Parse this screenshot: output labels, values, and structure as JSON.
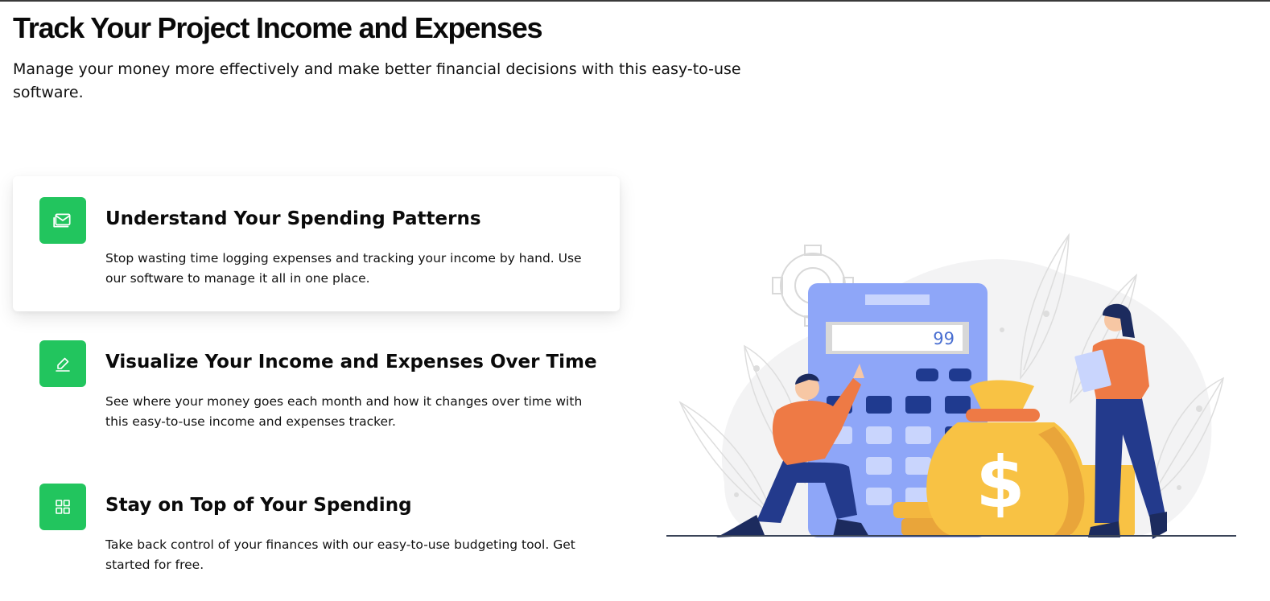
{
  "header": {
    "title": "Track Your Project Income and Expenses",
    "subtitle": "Manage your money more effectively and make better financial decisions with this easy-to-use software."
  },
  "features": [
    {
      "title": "Understand Your Spending Patterns",
      "text": "Stop wasting time logging expenses and tracking your income by hand. Use our software to manage it all in one place.",
      "icon": "mail-icon",
      "active": true
    },
    {
      "title": "Visualize Your Income and Expenses Over Time",
      "text": "See where your money goes each month and how it changes over time with this easy-to-use income and expenses tracker.",
      "icon": "edit-icon",
      "active": false
    },
    {
      "title": "Stay on Top of Your Spending",
      "text": "Take back control of your finances with our easy-to-use budgeting tool. Get started for free.",
      "icon": "grid-icon",
      "active": false
    }
  ],
  "illustration": {
    "calculator_display": "99",
    "money_symbol": "$"
  },
  "colors": {
    "accent": "#22c55e",
    "calculator": "#8ea6f8",
    "shirt": "#ee7a45",
    "pants": "#233a8c",
    "money_bag": "#f8c244"
  }
}
